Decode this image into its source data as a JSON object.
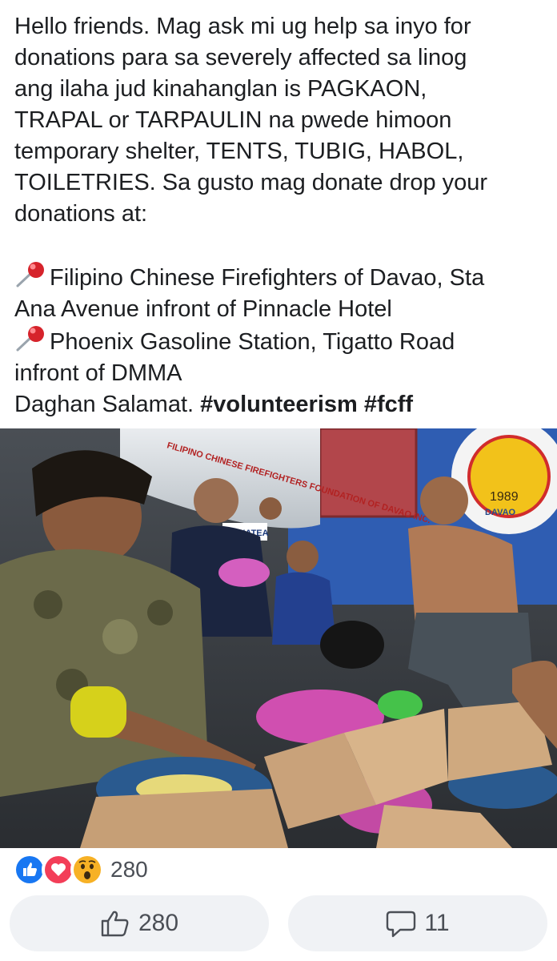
{
  "post": {
    "lines": [
      "Hello friends. Mag ask mi ug help sa inyo for",
      "donations para sa severely affected sa linog",
      "ang ilaha jud kinahanglan is PAGKAON,",
      "TRAPAL or TARPAULIN na pwede himoon",
      "temporary shelter, TENTS, TUBIG, HABOL,",
      "TOILETRIES. Sa gusto mag donate drop your",
      "donations at:"
    ],
    "location1_line1": "Filipino Chinese Firefighters of Davao, Sta",
    "location1_line2": "Ana Avenue infront of Pinnacle Hotel",
    "location2_line1": "Phoenix Gasoline Station, Tigatto Road",
    "location2_line2": "infront of DMMA",
    "closing": "Daghan Salamat.",
    "hashtag1": "#volunteerism",
    "hashtag2": "#fcff",
    "pin_icon": "round-pushpin-icon"
  },
  "photo": {
    "truck_text": "FILIPINO CHINESE FIREFIGHTERS FOUNDATION OF DAVAO INC.",
    "logo_year": "1989",
    "logo_city": "DAVAO",
    "sign_text": "DONATEA"
  },
  "reactions": {
    "icons": [
      "like-icon",
      "love-icon",
      "wow-icon"
    ],
    "count": "280",
    "colors": {
      "like": "#1877f2",
      "love": "#f33e58",
      "wow": "#f7b125"
    }
  },
  "actions": {
    "like_count": "280",
    "comment_count": "11"
  },
  "colors": {
    "button_bg": "#f0f2f5",
    "text": "#1c1e21",
    "muted": "#4b4f56"
  }
}
